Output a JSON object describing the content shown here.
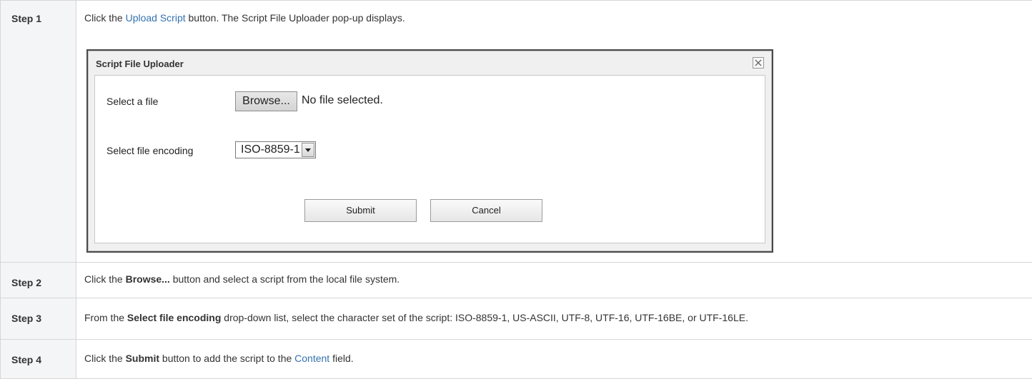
{
  "steps": [
    {
      "label": "Step 1",
      "text_before": "Click the ",
      "link": "Upload Script",
      "text_after": " button. The Script File Uploader pop-up displays."
    },
    {
      "label": "Step 2",
      "text_before": "Click the ",
      "bold": "Browse...",
      "text_after": " button and select a script from the local file system."
    },
    {
      "label": "Step 3",
      "text_before": "From the ",
      "bold": "Select file encoding",
      "text_after": " drop-down list, select the character set of the script: ISO-8859-1, US-ASCII, UTF-8, UTF-16, UTF-16BE, or UTF-16LE."
    },
    {
      "label": "Step 4",
      "text_before": "Click the ",
      "bold": "Submit",
      "text_middle": " button to add the script to the ",
      "link": "Content",
      "text_after": " field."
    }
  ],
  "dialog": {
    "title": "Script File Uploader",
    "file_label": "Select a file",
    "browse_label": "Browse...",
    "no_file_text": "No file selected.",
    "encoding_label": "Select file encoding",
    "encoding_value": "ISO-8859-1",
    "submit_label": "Submit",
    "cancel_label": "Cancel"
  },
  "colors": {
    "link": "#3572b0",
    "label_background": "#f4f5f7",
    "border": "#d6d6d6"
  },
  "icons": {
    "close": "close-icon",
    "dropdown": "chevron-down-icon"
  }
}
